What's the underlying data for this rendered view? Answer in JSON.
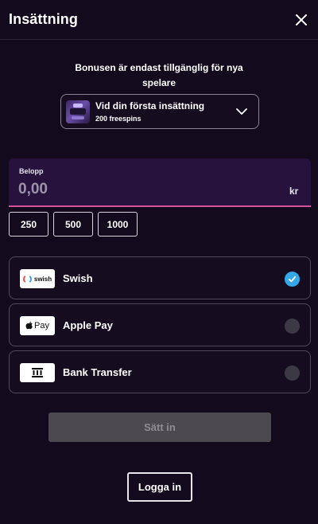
{
  "header": {
    "title": "Insättning",
    "close_icon": "close-icon"
  },
  "bonus": {
    "note": "Bonusen är endast tillgänglig för nya spelare",
    "selected_title": "Vid din första insättning",
    "selected_subtitle": "200 freespins",
    "dropdown_icon": "chevron-down-icon"
  },
  "amount": {
    "label": "Belopp",
    "placeholder": "0,00",
    "value": "",
    "currency": "kr",
    "underline_color": "#d6529c"
  },
  "quick_amounts": [
    "250",
    "500",
    "1000"
  ],
  "payment_methods": [
    {
      "id": "swish",
      "label": "Swish",
      "logo_text": "swish",
      "selected": true
    },
    {
      "id": "applepay",
      "label": "Apple Pay",
      "logo_text": "Pay",
      "selected": false
    },
    {
      "id": "bank",
      "label": "Bank Transfer",
      "logo_icon": "bank-icon",
      "selected": false
    }
  ],
  "actions": {
    "submit_label": "Sätt in",
    "login_label": "Logga in"
  },
  "colors": {
    "background": "#130a1d",
    "accent_check": "#35a8e8",
    "disabled_button": "#4c4a50"
  }
}
